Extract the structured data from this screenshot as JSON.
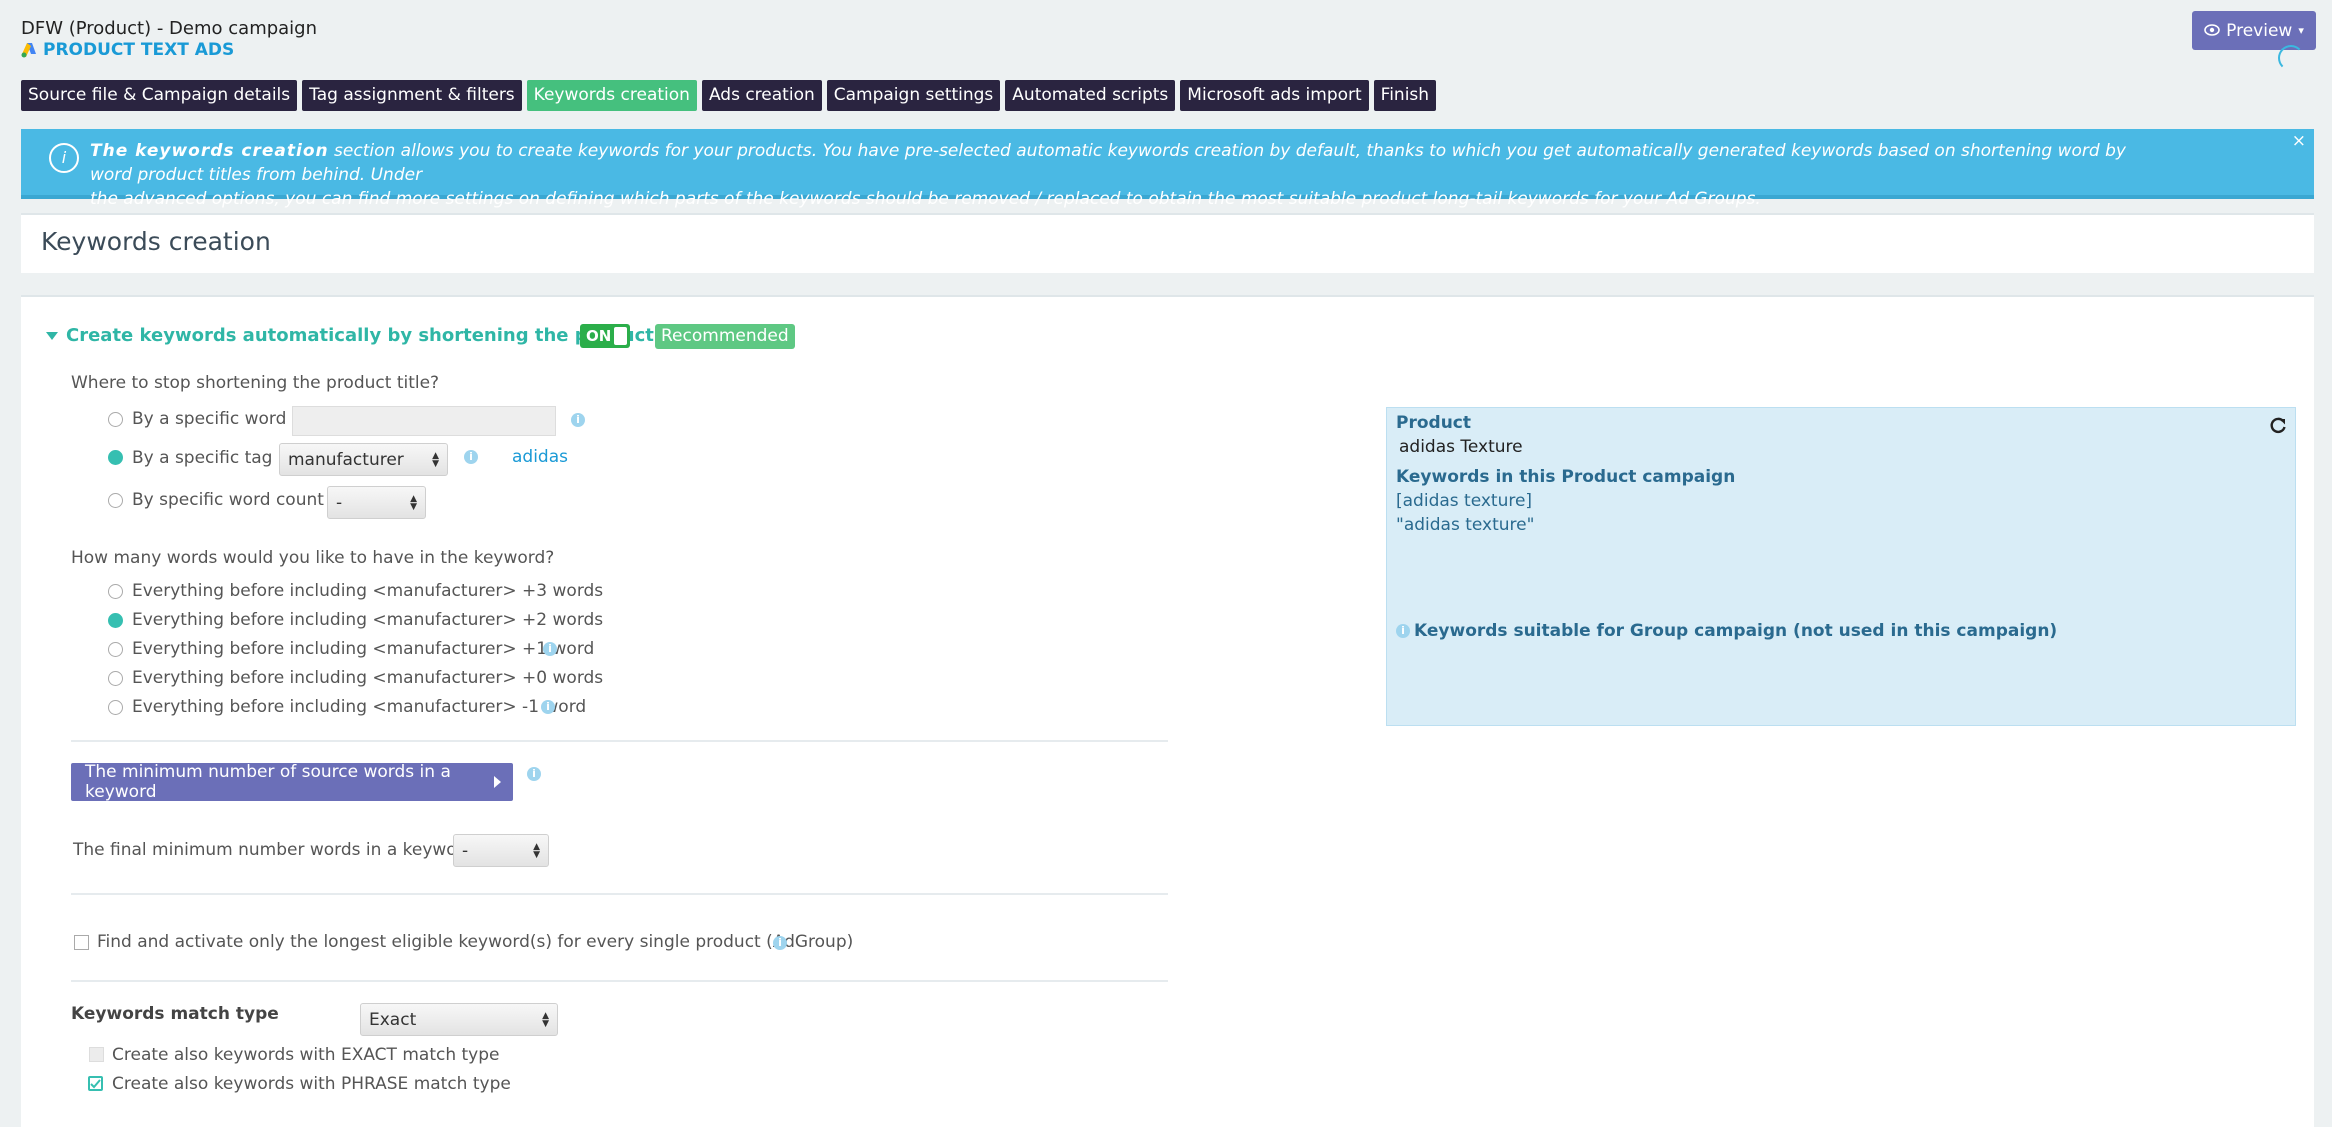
{
  "header": {
    "title": "DFW (Product) - Demo campaign",
    "brand": "PRODUCT TEXT ADS",
    "preview_label": "Preview"
  },
  "tabs": [
    {
      "label": "Source file & Campaign details",
      "active": false
    },
    {
      "label": "Tag assignment & filters",
      "active": false
    },
    {
      "label": "Keywords creation",
      "active": true
    },
    {
      "label": "Ads creation",
      "active": false
    },
    {
      "label": "Campaign settings",
      "active": false
    },
    {
      "label": "Automated scripts",
      "active": false
    },
    {
      "label": "Microsoft ads import",
      "active": false
    },
    {
      "label": "Finish",
      "active": false
    }
  ],
  "info": {
    "bold": "The keywords creation",
    "line1": " section allows you to create keywords for your products. You have pre-selected automatic keywords creation by default, thanks to which you get automatically generated keywords based on shortening word by word product titles from behind. Under",
    "line2": "the advanced options, you can find more settings on defining which parts of the keywords should be removed / replaced to obtain the most suitable product long-tail keywords for your Ad Groups.",
    "close": "×"
  },
  "page_title": "Keywords creation",
  "auto": {
    "title": "Create keywords automatically by shortening the product title",
    "switch_label": "ON",
    "badge": "Recommended",
    "stop_question": "Where to stop shortening the product title?",
    "stop_options": [
      {
        "label": "By a specific word",
        "selected": false
      },
      {
        "label": "By a specific tag",
        "selected": true
      },
      {
        "label": "By specific word count",
        "selected": false
      }
    ],
    "tag_select": "manufacturer",
    "tag_value": "adidas",
    "word_count_select": "-",
    "words_question": "How many words would you like to have in the keyword?",
    "words_options": [
      {
        "label": "Everything before including <manufacturer> +3 words",
        "selected": false
      },
      {
        "label": "Everything before including <manufacturer> +2 words",
        "selected": true
      },
      {
        "label": "Everything before including <manufacturer> +1 word",
        "selected": false
      },
      {
        "label": "Everything before including <manufacturer> +0 words",
        "selected": false
      },
      {
        "label": "Everything before including <manufacturer> -1 word",
        "selected": false
      }
    ],
    "min_source_button": "The minimum number of source words in a keyword",
    "final_min_label": "The final minimum number words in a keyword",
    "final_min_select": "-",
    "longest_label": "Find and activate only the longest eligible keyword(s) for every single product (AdGroup)",
    "match_type_label": "Keywords match type",
    "match_type_select": "Exact",
    "also_exact": "Create also keywords with EXACT match type",
    "also_phrase": "Create also keywords with PHRASE match type"
  },
  "preview_panel": {
    "product_title": "Product",
    "product_name": "adidas Texture",
    "keywords_title": "Keywords in this Product campaign",
    "keywords": [
      "[adidas texture]",
      "\"adidas texture\""
    ],
    "group_title": "Keywords suitable for Group campaign (not used in this campaign)"
  },
  "colors": {
    "accent_green": "#45c07e",
    "tab_dark": "#2a2440",
    "info_blue": "#4ab9e4",
    "purple": "#6b6fb8",
    "teal": "#36bfb1"
  },
  "icons": [
    "google-ads-logo-icon",
    "eye-icon",
    "caret-down-icon",
    "info-circle-icon",
    "close-icon",
    "refresh-icon",
    "chevron-right-icon"
  ]
}
